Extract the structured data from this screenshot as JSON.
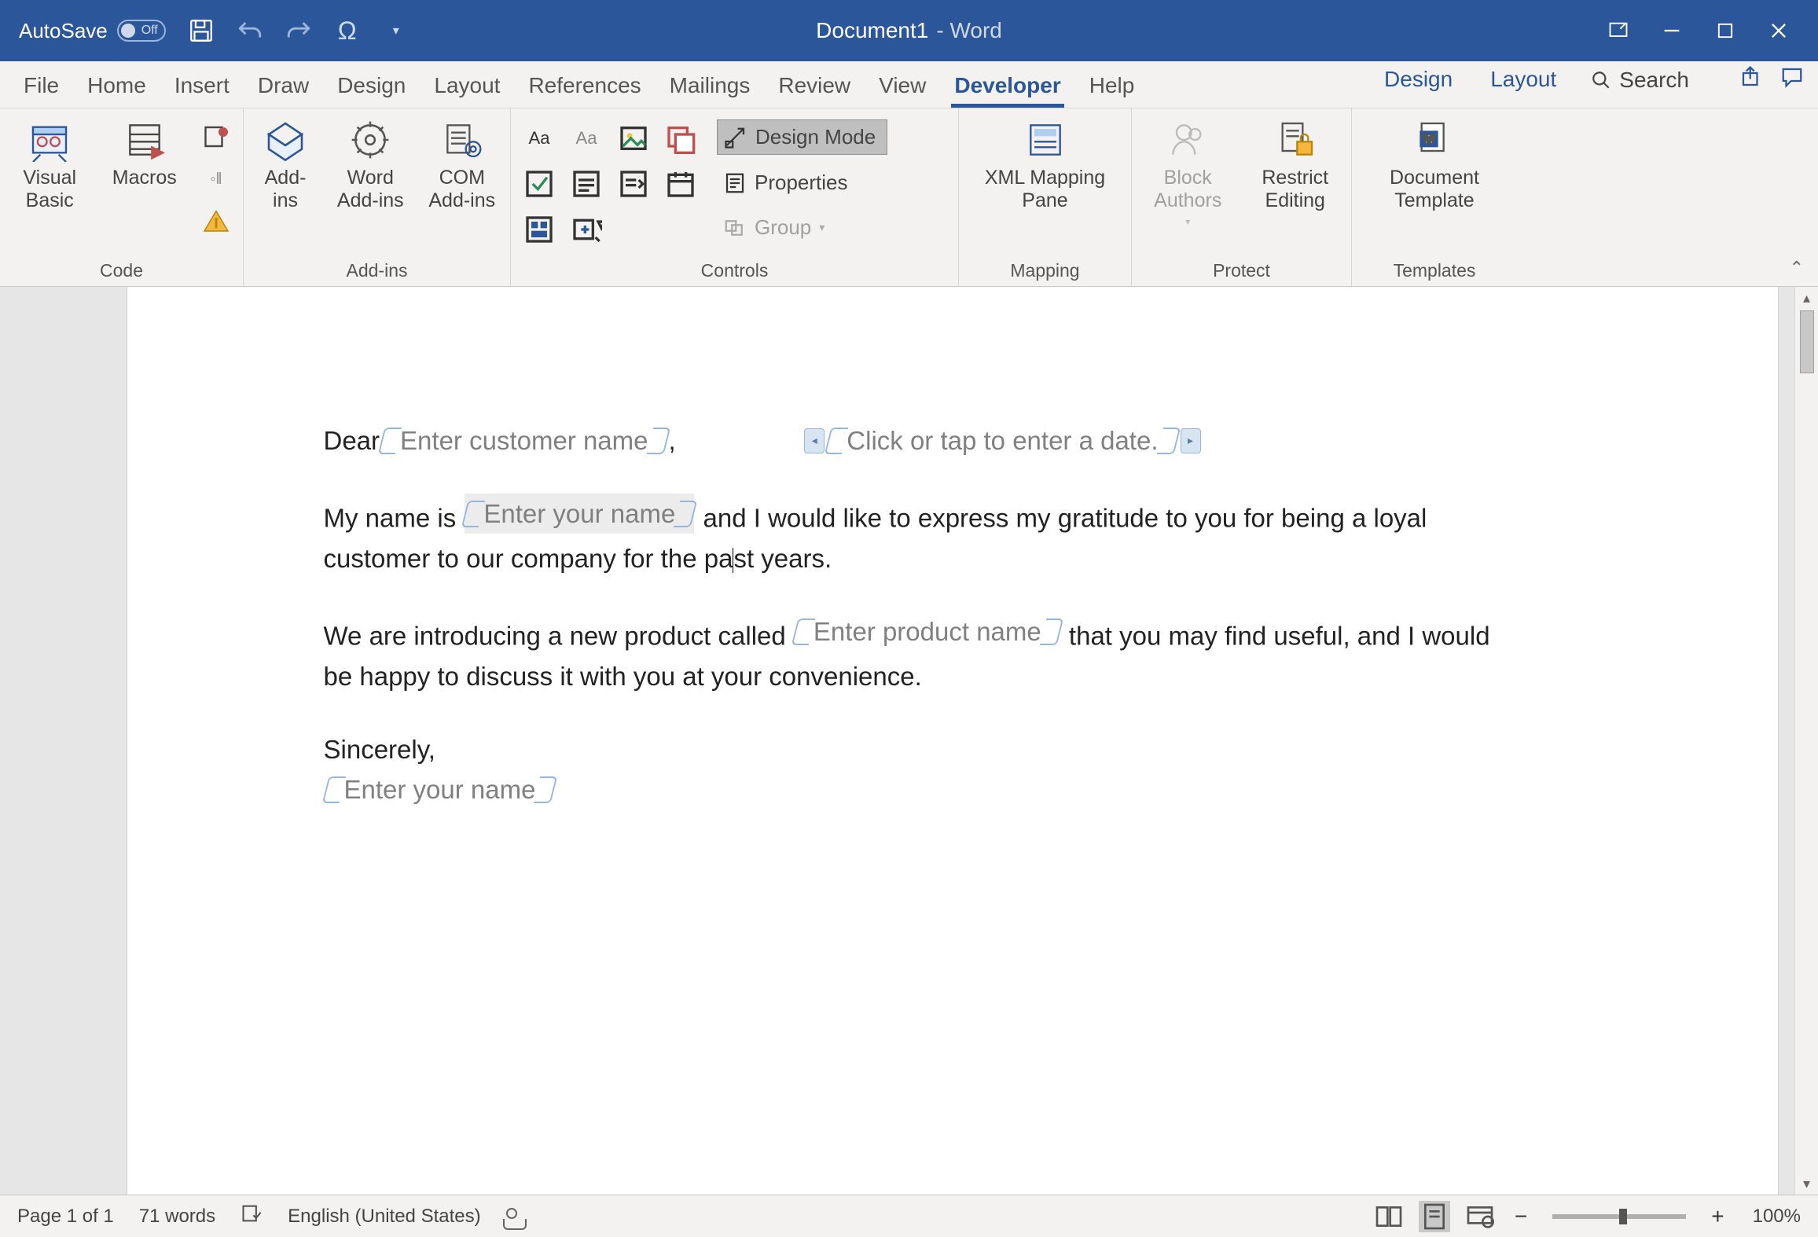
{
  "titlebar": {
    "autosave_label": "AutoSave",
    "autosave_state": "Off",
    "doc_name": "Document1",
    "app_suffix": "-  Word"
  },
  "tabs": {
    "items": [
      "File",
      "Home",
      "Insert",
      "Draw",
      "Design",
      "Layout",
      "References",
      "Mailings",
      "Review",
      "View",
      "Developer",
      "Help"
    ],
    "active": "Developer",
    "contextual": [
      "Design",
      "Layout"
    ],
    "search_label": "Search"
  },
  "ribbon": {
    "code": {
      "visual_basic": "Visual\nBasic",
      "macros": "Macros",
      "group_label": "Code"
    },
    "addins": {
      "addins": "Add-\nins",
      "word_addins": "Word\nAdd-ins",
      "com_addins": "COM\nAdd-ins",
      "group_label": "Add-ins"
    },
    "controls": {
      "design_mode": "Design Mode",
      "properties": "Properties",
      "group": "Group",
      "group_label": "Controls"
    },
    "mapping": {
      "xml_mapping": "XML Mapping\nPane",
      "group_label": "Mapping"
    },
    "protect": {
      "block_authors": "Block\nAuthors",
      "restrict_editing": "Restrict\nEditing",
      "group_label": "Protect"
    },
    "templates": {
      "doc_template": "Document\nTemplate",
      "group_label": "Templates"
    }
  },
  "document": {
    "dear": "Dear ",
    "cc_customer": "Enter customer name",
    "comma": " ,",
    "cc_date": "Click or tap to enter a date.",
    "p1a": "My name is ",
    "cc_yourname": "Enter your name",
    "p1b": " and I would like to express my gratitude to you for being a loyal customer to our company for the pa",
    "p1c": "st years.",
    "p2a": "We are introducing a new product called ",
    "cc_product": "Enter product name",
    "p2b": "  that you may find useful, and I would be happy to discuss it with you at your convenience.",
    "sincerely": "Sincerely,",
    "cc_sig": "Enter your name"
  },
  "statusbar": {
    "page": "Page 1 of 1",
    "words": "71 words",
    "language": "English (United States)",
    "zoom": "100%"
  }
}
